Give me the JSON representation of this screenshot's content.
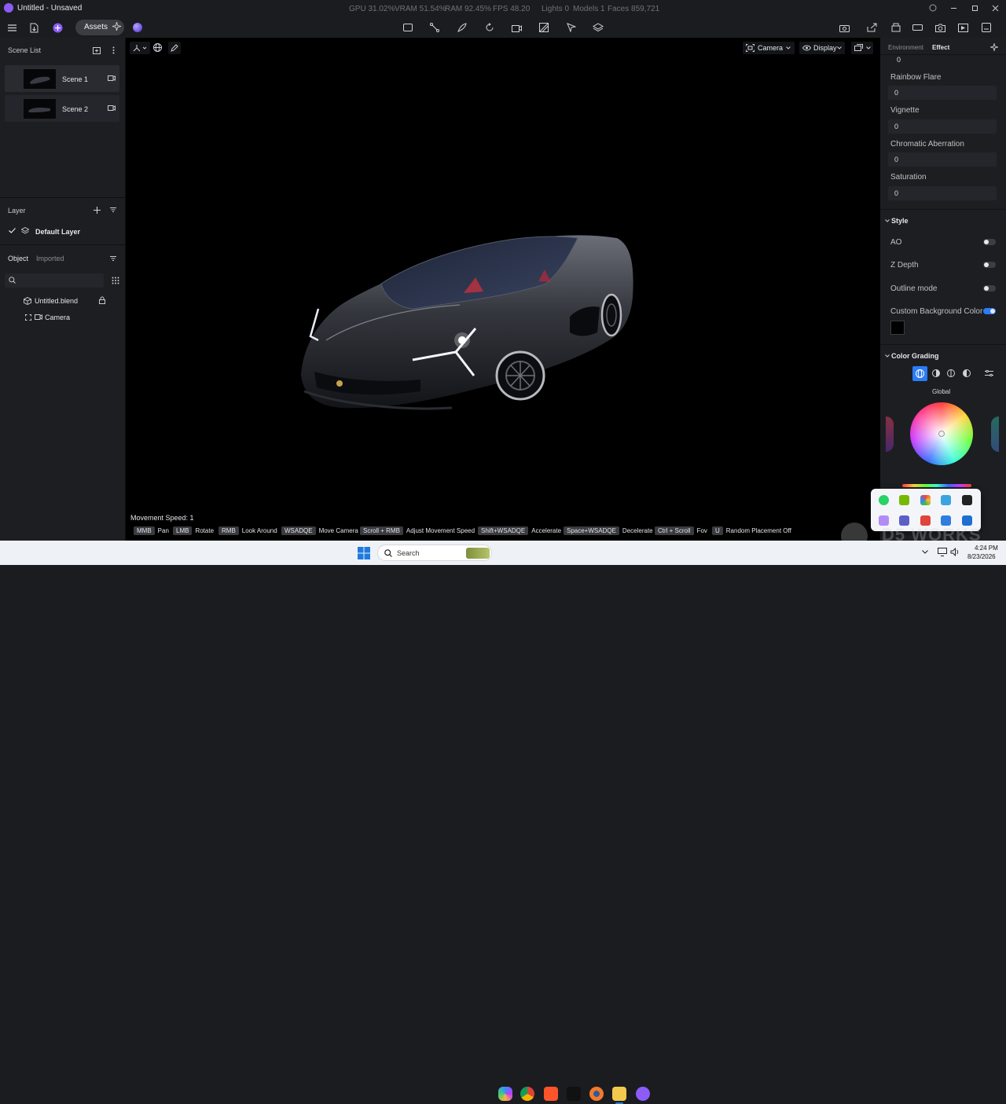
{
  "titlebar": {
    "title": "Untitled - Unsaved",
    "stats": {
      "gpu": "GPU 31.02%",
      "vram": "VRAM 51.54%",
      "ram": "RAM 92.45%",
      "fps": "FPS 48.20",
      "lights": "Lights 0",
      "models": "Models 1",
      "faces": "Faces 859,721"
    }
  },
  "toolbar": {
    "assets_label": "Assets",
    "left_icons": [
      "menu-icon",
      "import-icon",
      "ai-icon"
    ],
    "center_icons": [
      "rectangle-icon",
      "path-icon",
      "brush-icon",
      "rotate-icon",
      "camera-tool-icon",
      "grid-tool-icon",
      "select-tool-icon",
      "layers-tool-icon"
    ],
    "right_icons": [
      "render-icon",
      "share-icon",
      "export-icon",
      "capture-icon",
      "video-icon",
      "save-icon"
    ]
  },
  "scene_list": {
    "title": "Scene List",
    "scenes": [
      {
        "label": "Scene 1"
      },
      {
        "label": "Scene 2"
      }
    ]
  },
  "layer": {
    "title": "Layer",
    "default_layer": "Default Layer"
  },
  "objects": {
    "tab_object": "Object",
    "tab_imported": "Imported",
    "items": [
      {
        "label": "Untitled.blend"
      },
      {
        "label": "Camera"
      }
    ]
  },
  "viewport": {
    "camera_label": "Camera",
    "display_label": "Display",
    "movement_speed": "Movement Speed: 1",
    "hints": [
      {
        "key": "MMB",
        "action": "Pan"
      },
      {
        "key": "LMB",
        "action": "Rotate"
      },
      {
        "key": "RMB",
        "action": "Look Around"
      },
      {
        "key": "WSADQE",
        "action": "Move Camera"
      },
      {
        "key": "Scroll + RMB",
        "action": "Adjust Movement Speed"
      },
      {
        "key": "Shift+WSADQE",
        "action": "Accelerate"
      },
      {
        "key": "Space+WSADQE",
        "action": "Decelerate"
      },
      {
        "key": "Ctrl + Scroll",
        "action": "Fov"
      },
      {
        "key": "U",
        "action": "Random Placement Off"
      }
    ]
  },
  "right_panel": {
    "tab_environment": "Environment",
    "tab_effect": "Effect",
    "fields": {
      "top_value": "0",
      "rainbow_flare": {
        "label": "Rainbow Flare",
        "value": "0"
      },
      "vignette": {
        "label": "Vignette",
        "value": "0"
      },
      "chromatic_aberration": {
        "label": "Chromatic Aberration",
        "value": "0"
      },
      "saturation": {
        "label": "Saturation",
        "value": "0"
      }
    },
    "style": {
      "title": "Style",
      "ao": {
        "label": "AO",
        "on": false
      },
      "z_depth": {
        "label": "Z Depth",
        "on": false
      },
      "outline_mode": {
        "label": "Outline mode",
        "on": false
      },
      "custom_bg": {
        "label": "Custom Background Color",
        "on": true
      },
      "bg_color": "#000000"
    },
    "color_grading": {
      "title": "Color Grading",
      "global_label": "Global"
    }
  },
  "watermark": "D5 WORKS",
  "taskbar": {
    "search_placeholder": "Search",
    "time": "4:24 PM",
    "date": "8/23/2026"
  },
  "colors": {
    "accent": "#2b7cf6",
    "panel_bg": "#1d1e22",
    "viewport_bg": "#000000"
  }
}
